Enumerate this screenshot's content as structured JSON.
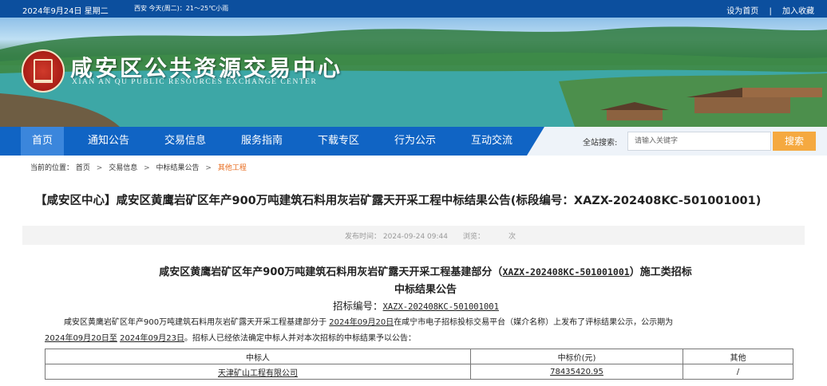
{
  "topbar": {
    "date": "2024年9月24日 星期二",
    "weather": "西安  今天(周二)：21～25℃小雨",
    "set_home": "设为首页",
    "separator": "|",
    "favorite": "加入收藏"
  },
  "banner": {
    "title": "咸安区公共资源交易中心",
    "subtitle": "XIAN AN QU PUBLIC RESOURCES EXCHANGE CENTER"
  },
  "nav": {
    "items": [
      "首页",
      "通知公告",
      "交易信息",
      "服务指南",
      "下载专区",
      "行为公示",
      "互动交流"
    ],
    "search_label": "全站搜索:",
    "search_placeholder": "请输入关键字",
    "search_button": "搜索"
  },
  "breadcrumb": {
    "label": "当前的位置：",
    "items": [
      "首页",
      "交易信息",
      "中标结果公告"
    ],
    "current": "其他工程",
    "sep": ">"
  },
  "article": {
    "title": "【咸安区中心】咸安区黄鹰岩矿区年产900万吨建筑石料用灰岩矿露天开采工程中标结果公告(标段编号：XAZX-202408KC-501001001)",
    "pub_label": "发布时间：",
    "pub_time": "2024-09-24 09:44",
    "views_label": "浏览：",
    "views_unit": "次",
    "heading1_a": "咸安区黄鹰岩矿区年产900万吨建筑石料用灰岩矿露天开采工程基建部分（",
    "heading1_code": "XAZX-202408KC-501001001",
    "heading1_b": "）施工类招标",
    "heading2": "中标结果公告",
    "bid_label": "招标编号：",
    "bid_code": "XAZX-202408KC-501001001",
    "para_a": "咸安区黄鹰岩矿区年产900万吨建筑石料用灰岩矿露天开采工程基建部分于",
    "para_date1": "2024年09月20日",
    "para_b": "在咸宁市电子招标投标交易平台（媒介名称）上发布了评标结果公示，公示期为",
    "para_date2": "2024年09月20日至",
    "para_date3": "2024年09月23日",
    "para_c": "。招标人已经依法确定中标人并对本次招标的中标结果予以公告：",
    "table": {
      "headers": [
        "中标人",
        "中标价(元)",
        "其他"
      ],
      "rows": [
        [
          "天津矿山工程有限公司",
          "78435420.95",
          "/"
        ]
      ]
    }
  }
}
